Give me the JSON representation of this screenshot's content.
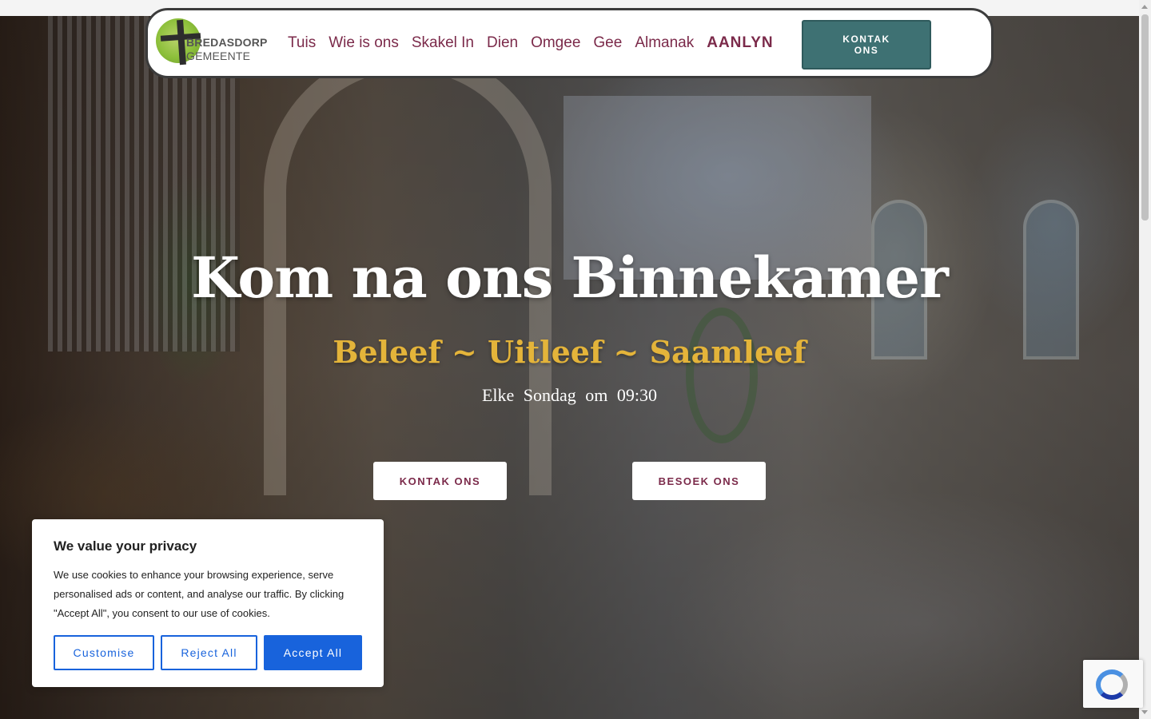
{
  "header": {
    "logo": {
      "line1": "BREDASDORP",
      "line2": "GEMEENTE"
    },
    "nav": [
      {
        "label": "Tuis"
      },
      {
        "label": "Wie is ons"
      },
      {
        "label": "Skakel In"
      },
      {
        "label": "Dien"
      },
      {
        "label": "Omgee"
      },
      {
        "label": "Gee"
      },
      {
        "label": "Almanak"
      },
      {
        "label": "AANLYN"
      }
    ],
    "contact_button": "KONTAK ONS"
  },
  "hero": {
    "title": "Kom na ons Binnekamer",
    "subtitle": "Beleef ~ Uitleef ~ Saamleef",
    "service_time": "Elke Sondag om 09:30",
    "buttons": {
      "contact": "KONTAK ONS",
      "visit": "BESOEK ONS"
    }
  },
  "cookie_banner": {
    "title": "We value your privacy",
    "text": "We use cookies to enhance your browsing experience, serve personalised ads or content, and analyse our traffic. By clicking \"Accept All\", you consent to our use of cookies.",
    "buttons": {
      "customise": "Customise",
      "reject": "Reject All",
      "accept": "Accept All"
    }
  },
  "colors": {
    "nav_text": "#7b2a4a",
    "contact_button_bg": "#3e7173",
    "subtitle": "#e4b43a",
    "cookie_accent": "#1863dc"
  },
  "icons": {
    "recaptcha": "recaptcha-icon",
    "logo": "cross-logo-icon"
  }
}
